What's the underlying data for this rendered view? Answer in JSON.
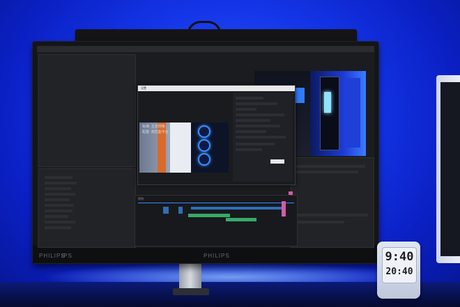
{
  "monitor": {
    "brand_chin": "PHILIPS",
    "panel_type": "IPS",
    "brand_center": "PHILIPS"
  },
  "editor": {
    "dialog_title": "设置",
    "preview_overlay_line1": "标准: 主流规格",
    "preview_overlay_line2": "配置: 高性能平台",
    "timeline_label": "序列",
    "icon_names": [
      "play-icon",
      "film-icon",
      "folder-icon"
    ]
  },
  "clock": {
    "time": "9:40",
    "date": "20:40"
  },
  "colors": {
    "wall_light": "#1436e8",
    "ui_accent": "#3a8cff",
    "clip_green": "#37a96a",
    "clip_blue": "#2e6fb7",
    "clip_pink": "#d45aa7"
  }
}
